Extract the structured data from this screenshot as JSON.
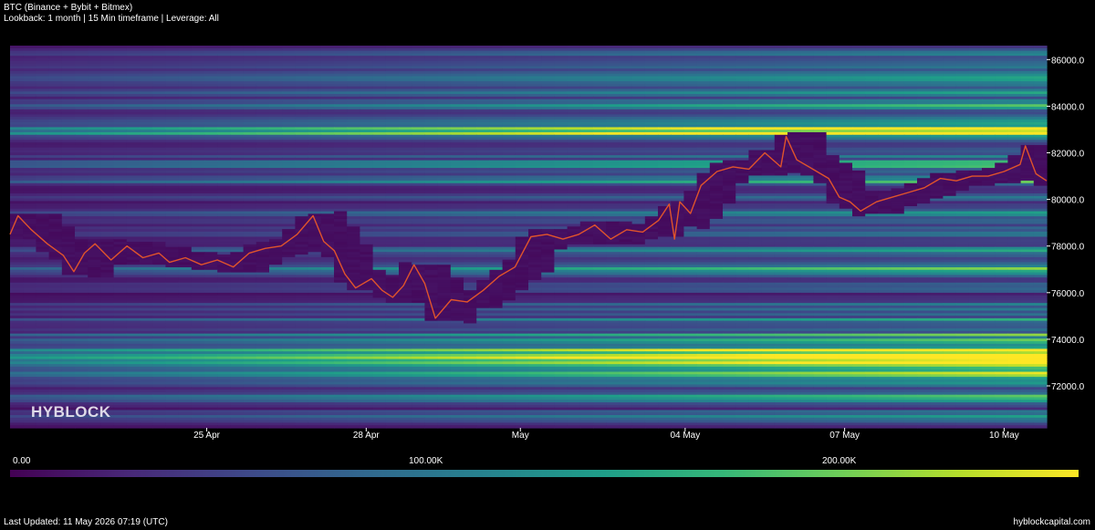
{
  "header": {
    "title": "BTC (Binance + Bybit + Bitmex)",
    "subtitle": "Lookback: 1 month | 15 Min timeframe | Leverage: All"
  },
  "watermark": "HYBLOCK",
  "colorbar": {
    "ticks": [
      "0.00",
      "100.00K",
      "200.00K"
    ],
    "tick_values": [
      0,
      100000,
      200000
    ],
    "max": 245000,
    "colormap": "viridis",
    "colors": [
      "#440154",
      "#482878",
      "#3e4989",
      "#31688e",
      "#26828e",
      "#1f9e89",
      "#35b779",
      "#6ece58",
      "#b5de2b",
      "#fde725"
    ]
  },
  "footer": {
    "updated": "Last Updated: 11 May 2026 07:19 (UTC)",
    "site": "hyblockcapital.com"
  },
  "chart_data": {
    "type": "heatmap",
    "title": "BTC (Binance + Bybit + Bitmex)",
    "subtitle": "Lookback: 1 month | 15 Min timeframe | Leverage: All",
    "x_ticks": [
      "25 Apr",
      "28 Apr",
      "May",
      "04 May",
      "07 May",
      "10 May"
    ],
    "x_tick_days": [
      3.7,
      6.7,
      9.6,
      12.7,
      15.7,
      18.7
    ],
    "x_range_days": [
      0,
      19.5
    ],
    "y_ticks": [
      "72000.0",
      "74000.0",
      "76000.0",
      "78000.0",
      "80000.0",
      "82000.0",
      "84000.0",
      "86000.0"
    ],
    "y_tick_values": [
      72000,
      74000,
      76000,
      78000,
      80000,
      82000,
      84000,
      86000
    ],
    "ylim": [
      70200,
      86600
    ],
    "color_range": [
      0,
      245000
    ],
    "price_series": {
      "name": "BTC price",
      "x_days": [
        0,
        0.15,
        0.4,
        0.7,
        1.0,
        1.2,
        1.4,
        1.6,
        1.9,
        2.2,
        2.5,
        2.8,
        3.0,
        3.3,
        3.6,
        3.9,
        4.2,
        4.5,
        4.8,
        5.1,
        5.4,
        5.7,
        5.9,
        6.1,
        6.3,
        6.5,
        6.8,
        7.0,
        7.2,
        7.4,
        7.6,
        7.8,
        8.0,
        8.3,
        8.6,
        8.9,
        9.2,
        9.5,
        9.8,
        10.1,
        10.4,
        10.7,
        11.0,
        11.3,
        11.6,
        11.9,
        12.2,
        12.4,
        12.5,
        12.6,
        12.8,
        13.0,
        13.3,
        13.6,
        13.9,
        14.2,
        14.5,
        14.6,
        14.8,
        15.1,
        15.4,
        15.6,
        15.8,
        16.0,
        16.3,
        16.6,
        16.9,
        17.2,
        17.5,
        17.8,
        18.1,
        18.4,
        18.7,
        19.0,
        19.1,
        19.3,
        19.5
      ],
      "y_prices": [
        78500,
        79300,
        78700,
        78100,
        77600,
        76900,
        77700,
        78100,
        77400,
        78000,
        77500,
        77700,
        77300,
        77500,
        77200,
        77400,
        77100,
        77700,
        77900,
        78000,
        78500,
        79300,
        78200,
        77800,
        76800,
        76200,
        76600,
        76100,
        75800,
        76300,
        77200,
        76400,
        74900,
        75700,
        75600,
        76100,
        76700,
        77100,
        78400,
        78500,
        78300,
        78500,
        78900,
        78300,
        78700,
        78600,
        79100,
        79800,
        78300,
        79900,
        79400,
        80600,
        81200,
        81400,
        81300,
        82000,
        81400,
        82700,
        81700,
        81300,
        80900,
        80100,
        79900,
        79500,
        79900,
        80100,
        80300,
        80500,
        80900,
        80800,
        81000,
        81000,
        81200,
        81500,
        82300,
        81100,
        80800
      ]
    },
    "liquidity_bands": [
      {
        "price": 70700,
        "value": 90000
      },
      {
        "price": 71500,
        "value": 110000
      },
      {
        "price": 72100,
        "value": 80000
      },
      {
        "price": 72600,
        "value": 150000
      },
      {
        "price": 73100,
        "value": 200000
      },
      {
        "price": 73500,
        "value": 225000
      },
      {
        "price": 74100,
        "value": 120000
      },
      {
        "price": 74800,
        "value": 85000
      },
      {
        "price": 75400,
        "value": 60000
      },
      {
        "price": 76300,
        "value": 70000
      },
      {
        "price": 77000,
        "value": 110000
      },
      {
        "price": 77800,
        "value": 80000
      },
      {
        "price": 78600,
        "value": 70000
      },
      {
        "price": 79300,
        "value": 90000
      },
      {
        "price": 80100,
        "value": 60000
      },
      {
        "price": 80800,
        "value": 100000
      },
      {
        "price": 81500,
        "value": 120000
      },
      {
        "price": 82100,
        "value": 90000
      },
      {
        "price": 82900,
        "value": 215000
      },
      {
        "price": 83400,
        "value": 80000
      },
      {
        "price": 84100,
        "value": 110000
      },
      {
        "price": 84700,
        "value": 95000
      },
      {
        "price": 85300,
        "value": 100000
      },
      {
        "price": 85900,
        "value": 75000
      },
      {
        "price": 86400,
        "value": 55000
      }
    ]
  }
}
